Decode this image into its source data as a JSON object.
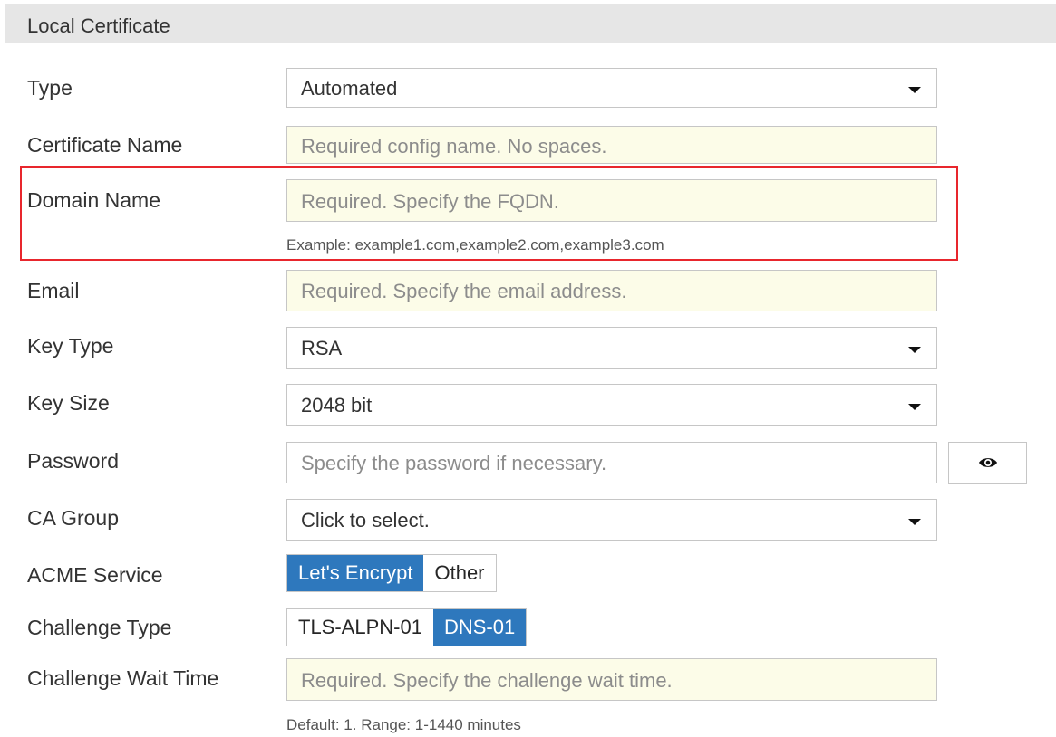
{
  "section": {
    "title": "Local Certificate"
  },
  "fields": {
    "type": {
      "label": "Type",
      "value": "Automated"
    },
    "certificate_name": {
      "label": "Certificate Name",
      "placeholder": "Required config name. No spaces."
    },
    "domain_name": {
      "label": "Domain Name",
      "placeholder": "Required. Specify the FQDN.",
      "hint": "Example: example1.com,example2.com,example3.com"
    },
    "email": {
      "label": "Email",
      "placeholder": "Required. Specify the email address."
    },
    "key_type": {
      "label": "Key Type",
      "value": "RSA"
    },
    "key_size": {
      "label": "Key Size",
      "value": "2048 bit"
    },
    "password": {
      "label": "Password",
      "placeholder": "Specify the password if necessary.",
      "toggle_icon": "eye-icon"
    },
    "ca_group": {
      "label": "CA Group",
      "value": "Click to select."
    },
    "acme_service": {
      "label": "ACME Service",
      "options": [
        "Let's Encrypt",
        "Other"
      ],
      "selected": "Let's Encrypt"
    },
    "challenge_type": {
      "label": "Challenge Type",
      "options": [
        "TLS-ALPN-01",
        "DNS-01"
      ],
      "selected": "DNS-01"
    },
    "challenge_wait_time": {
      "label": "Challenge Wait Time",
      "placeholder": "Required. Specify the challenge wait time.",
      "hint": "Default: 1. Range: 1-1440 minutes"
    }
  },
  "colors": {
    "accent": "#2e78bd",
    "required_bg": "#fcfce8",
    "highlight": "#e8262d",
    "header_bg": "#e6e6e6"
  }
}
